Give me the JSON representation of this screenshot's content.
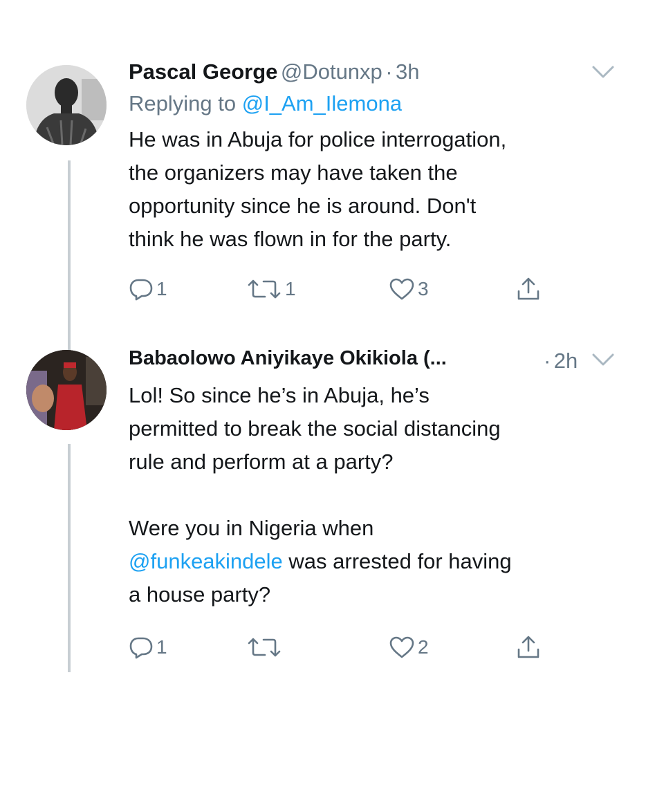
{
  "tweets": [
    {
      "author_name": "Pascal George",
      "handle": "@Dotunxp",
      "separator": "·",
      "time": "3h",
      "reply_prefix": "Replying to",
      "reply_handle": "@I_Am_Ilemona",
      "text_lines": [
        "He was in Abuja for police interrogation,",
        "the organizers may have taken the",
        "opportunity since he is around. Don't",
        "think he was flown in for the party."
      ],
      "reply_count": "1",
      "retweet_count": "1",
      "like_count": "3"
    },
    {
      "author_name": "Babaolowo Aniyikaye Okikiola (...",
      "separator": "·",
      "time": "2h",
      "paragraph1_lines": [
        "Lol! So since he’s in Abuja, he’s",
        "permitted to break the social distancing",
        "rule and perform at a party?"
      ],
      "paragraph2_line1": "Were you in Nigeria when",
      "paragraph2_mention": "@funkeakindele",
      "paragraph2_line2_rest": " was arrested for having",
      "paragraph2_line3": "a house party?",
      "reply_count": "1",
      "retweet_count": "",
      "like_count": "2"
    }
  ],
  "colors": {
    "text": "#14171a",
    "secondary": "#657786",
    "link": "#1da1f2",
    "thread_line": "#c7ced3",
    "background": "#ffffff"
  },
  "icons": [
    "reply-icon",
    "retweet-icon",
    "like-icon",
    "share-icon",
    "chevron-down-icon"
  ]
}
